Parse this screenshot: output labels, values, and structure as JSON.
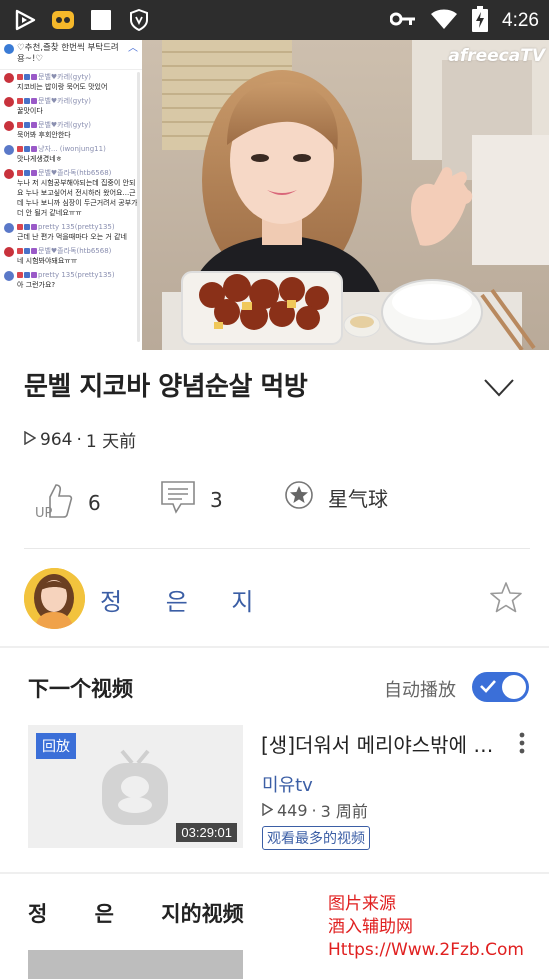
{
  "status_bar": {
    "time": "4:26",
    "icons": [
      "play-app-icon",
      "chat-app-icon",
      "square-icon",
      "shield-icon",
      "key-icon",
      "wifi-icon",
      "battery-charging-icon"
    ]
  },
  "video": {
    "watermark": "afreecaTV",
    "chat": {
      "notice": "♡추천,즐찾 한번씩 부탁드려용~!♡",
      "messages": [
        {
          "nick": "문벨♥카레(gyty)",
          "text": "지코비는 밥이랑 묵어도 맛있어"
        },
        {
          "nick": "문벨♥카레(gyty)",
          "text": "꿀맛이다"
        },
        {
          "nick": "문벨♥카레(gyty)",
          "text": "묵어봐 후회안한다"
        },
        {
          "nick": "냥자... (iwonjung11)",
          "text": "맛나게생겼네ㅎ"
        },
        {
          "nick": "문벨♥졸라독(htb6568)",
          "text": "누나 저 시험공부해야되는데 집중이 안되요 누나 보고싶어서 전시하러 왔어요...근데 누나 보니까 심장이 두근거려서 공부가 더 안 될거 같네요ㅠㅠ"
        },
        {
          "nick": "pretty 135(pretty135)",
          "text": "근데 난 편가 먹을때마다 오는 거 같네"
        },
        {
          "nick": "문벨♥졸라독(htb6568)",
          "text": "네 시험봐야돼요ㅠㅠ"
        },
        {
          "nick": "pretty 135(pretty135)",
          "text": "아 그런가요?"
        }
      ]
    }
  },
  "title": "문벨 지코바 양념순살 먹방",
  "meta": {
    "views": "964",
    "separator": "·",
    "time_ago": "1 天前"
  },
  "actions": {
    "like_count": "6",
    "like_icon_text": "UP",
    "comment_count": "3",
    "star_label": "星气球"
  },
  "channel": {
    "name": "정 은 지"
  },
  "next_video": {
    "section_title": "下一个视频",
    "autoplay_label": "自动播放",
    "autoplay_on": true,
    "badge": "回放",
    "duration": "03:29:01",
    "title": "[생]더워서 메리야스밖에 못입겠다",
    "channel": "미유tv",
    "views": "449",
    "separator": "·",
    "time_ago": "3 周前",
    "tag": "观看最多的视频"
  },
  "channel_videos": {
    "name_part": "정 은 ",
    "suffix": "지的视频"
  },
  "overlay_watermark": {
    "line1": "图片来源",
    "line2": "酒入辅助网",
    "line3": "Https://Www.2Fzb.Com"
  },
  "colors": {
    "accent": "#3b6fd8",
    "channel_blue": "#3b5ea5",
    "watermark_red": "#e02020"
  }
}
